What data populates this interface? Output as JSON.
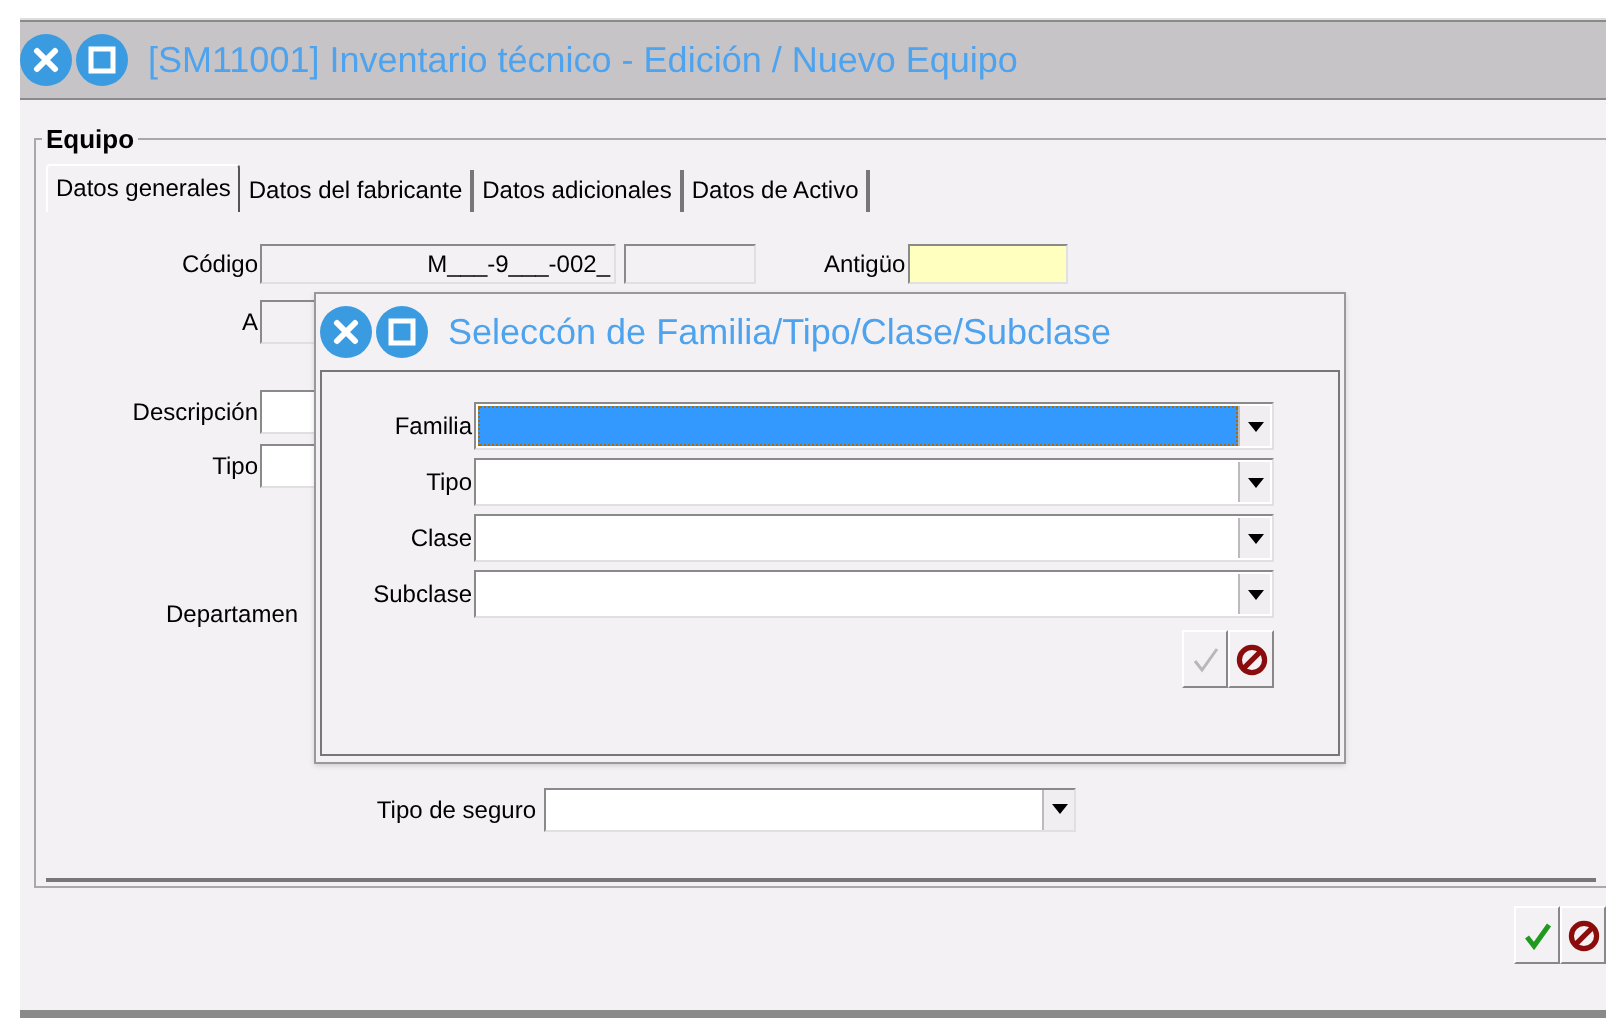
{
  "window": {
    "title": "[SM11001] Inventario técnico - Edición / Nuevo Equipo"
  },
  "group": {
    "title": "Equipo"
  },
  "tabs": [
    {
      "label": "Datos generales",
      "selected": true
    },
    {
      "label": "Datos del fabricante",
      "selected": false
    },
    {
      "label": "Datos adicionales",
      "selected": false
    },
    {
      "label": "Datos de Activo",
      "selected": false
    }
  ],
  "form": {
    "codigo": {
      "label": "Código",
      "value": "M___-9___-002_"
    },
    "antiguo": {
      "label": "Antigüo"
    },
    "a": {
      "label": "A"
    },
    "descripcion": {
      "label": "Descripción"
    },
    "tipo": {
      "label": "Tipo"
    },
    "departamento": {
      "label": "Departamen"
    },
    "tipo_seguro": {
      "label": "Tipo de seguro"
    }
  },
  "dialog": {
    "title": "Seleccón de Familia/Tipo/Clase/Subclase",
    "fields": [
      {
        "label": "Familia",
        "selected": true
      },
      {
        "label": "Tipo",
        "selected": false
      },
      {
        "label": "Clase",
        "selected": false
      },
      {
        "label": "Subclase",
        "selected": false
      }
    ],
    "accept": {
      "disabled": true
    }
  },
  "accept": {
    "disabled": false
  }
}
